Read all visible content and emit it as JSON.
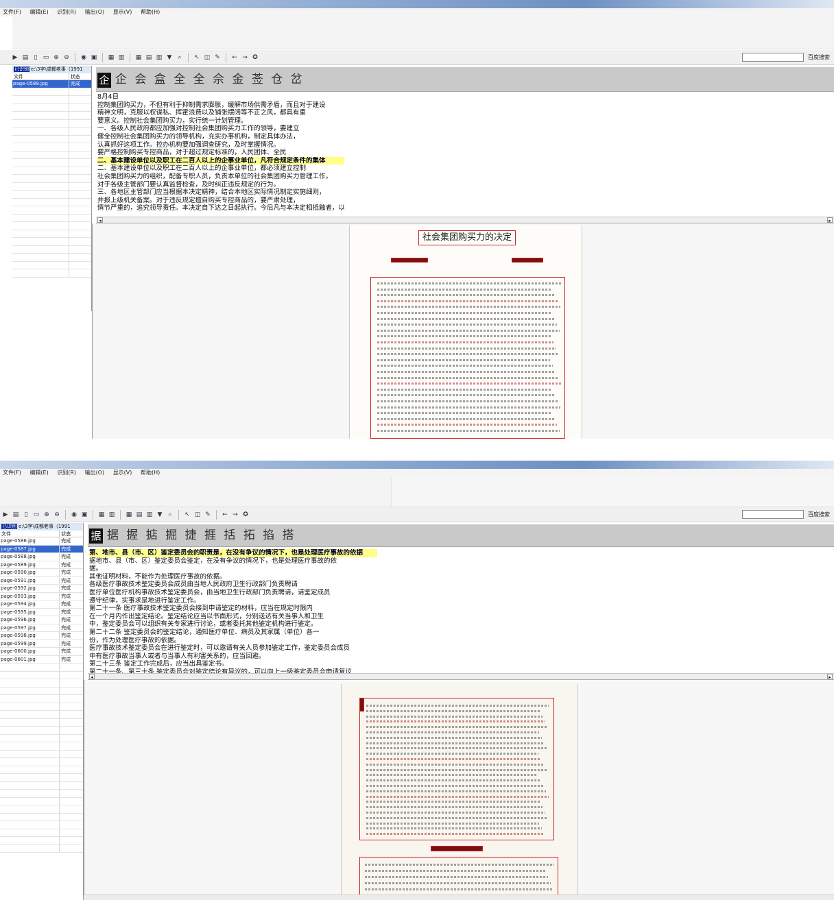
{
  "window1": {
    "title": "",
    "menu": [
      "文件(F)",
      "编辑(E)",
      "识别(R)",
      "输出(O)",
      "显示(V)",
      "帮助(H)"
    ],
    "search_placeholder": "",
    "search_button": "百度搜索",
    "sidebar": {
      "header_tag": "已识别",
      "header_text": "e:\\3字\\成都老事（1991",
      "col_file": "文件",
      "col_status": "状态",
      "rows": [
        {
          "file": "page-0589.jpg",
          "status": "完成",
          "selected": true
        }
      ]
    },
    "glyph_candidates": {
      "selected": "企",
      "candidates": "企 会 盒 全   全 佘 金 莶   仓 岔"
    },
    "text_lines": [
      {
        "text": "8月4日",
        "style": "plain"
      },
      {
        "text": "控制集团购买力，不但有利于抑制需求膨胀，缓解市场供需矛盾，而且对于建设",
        "style": "plain"
      },
      {
        "text": "精神文明，克服以权谋私、挥霍浪费以及铺张摆阔等不正之风，都具有重",
        "style": "plain"
      },
      {
        "text": "要意义。控制社会集团购买力，实行统一计划管理。",
        "style": "plain"
      },
      {
        "text": "一、各级人民政府都应加强对控制社会集团购买力工作的领导，要建立",
        "style": "plain"
      },
      {
        "text": "健全控制社会集团购买力的领导机构，充实办事机构，制定具体办法，",
        "style": "plain"
      },
      {
        "text": "认真抓好这项工作。控办机构要加强调查研究，及时掌握情况。",
        "style": "plain"
      },
      {
        "text": "要严格控制购买专控商品，对于超过规定标准的，人民团体、全民",
        "style": "plain"
      },
      {
        "text": "二、基本建设单位以及职工在二百人以上的企事业单位，凡符合规定条件的集体",
        "style": "hl"
      },
      {
        "text": "二、基本建设单位以及职工在二百人以上的企事业单位，都必须建立控制",
        "style": "plain"
      },
      {
        "text": "社会集团购买力的组织，配备专职人员，负责本单位的社会集团购买力管理工作，",
        "style": "plain"
      },
      {
        "text": "对于各级主管部门要认真监督检查，及时纠正违反规定的行为。",
        "style": "plain"
      },
      {
        "text": "",
        "style": "plain"
      },
      {
        "text": "三、各地区主管部门应当根据本决定精神，结合本地区实际情况制定实施细则，",
        "style": "plain"
      },
      {
        "text": "并报上级机关备案。对于违反规定擅自购买专控商品的，要严肃处理，",
        "style": "plain"
      },
      {
        "text": "情节严重的，追究领导责任。本决定自下达之日起执行。今后凡与本决定相抵触者，以本决定为准",
        "style": "plain"
      }
    ],
    "scan": {
      "title": "社会集团购买力的决定"
    }
  },
  "window2": {
    "title": "",
    "menu": [
      "文件(F)",
      "编辑(E)",
      "识别(R)",
      "输出(O)",
      "显示(V)",
      "帮助(H)"
    ],
    "search_placeholder": "",
    "search_button": "百度搜索",
    "sidebar": {
      "header_tag": "已识别",
      "header_text": "e:\\3字\\成都老事（1991",
      "col_file": "文件",
      "col_status": "状态",
      "rows": [
        {
          "file": "page-0586.jpg",
          "status": "完成",
          "selected": false
        },
        {
          "file": "page-0587.jpg",
          "status": "完成",
          "selected": true
        },
        {
          "file": "page-0588.jpg",
          "status": "完成",
          "selected": false
        },
        {
          "file": "page-0589.jpg",
          "status": "完成",
          "selected": false
        },
        {
          "file": "page-0590.jpg",
          "status": "完成",
          "selected": false
        },
        {
          "file": "page-0591.jpg",
          "status": "完成",
          "selected": false
        },
        {
          "file": "page-0592.jpg",
          "status": "完成",
          "selected": false
        },
        {
          "file": "page-0593.jpg",
          "status": "完成",
          "selected": false
        },
        {
          "file": "page-0594.jpg",
          "status": "完成",
          "selected": false
        },
        {
          "file": "page-0595.jpg",
          "status": "完成",
          "selected": false
        },
        {
          "file": "page-0596.jpg",
          "status": "完成",
          "selected": false
        },
        {
          "file": "page-0597.jpg",
          "status": "完成",
          "selected": false
        },
        {
          "file": "page-0598.jpg",
          "status": "完成",
          "selected": false
        },
        {
          "file": "page-0599.jpg",
          "status": "完成",
          "selected": false
        },
        {
          "file": "page-0600.jpg",
          "status": "完成",
          "selected": false
        },
        {
          "file": "page-0601.jpg",
          "status": "完成",
          "selected": false
        }
      ]
    },
    "glyph_candidates": {
      "selected": "据",
      "candidates": "据 握 掂 掘   捷 捱 括 拓   掐 搭"
    },
    "text_lines": [
      {
        "text": "第、地市、县（市、区）鉴定委员会的职责是，在没有争议的情况下，也是处理医疗事故的依据",
        "style": "hl"
      },
      {
        "text": "据地市、县（市、区）鉴定委员会鉴定，在没有争议的情况下，也是处理医疗事故的依",
        "style": "plain"
      },
      {
        "text": "据。",
        "style": "plain"
      },
      {
        "text": "    其他证明材料，不能作为处理医疗事故的依据。",
        "style": "plain"
      },
      {
        "text": "    各级医疗事故技术鉴定委员会成员由当地人民政府卫生行政部门负责聘请",
        "style": "plain"
      },
      {
        "text": "医疗单位医疗机构事故技术鉴定委员会，由当地卫生行政部门负责聘请，请鉴定成员",
        "style": "plain"
      },
      {
        "text": "遵守纪律，实事求是地进行鉴定工作。",
        "style": "plain"
      },
      {
        "text": "    第二十一条  医疗事故技术鉴定委员会接到申请鉴定的材料，应当在规定时限内",
        "style": "plain"
      },
      {
        "text": "在一个月内作出鉴定结论。鉴定结论应当以书面形式，分别送达有关当事人和卫生",
        "style": "plain"
      },
      {
        "text": "中，鉴定委员会可以组织有关专家进行讨论，或者委托其他鉴定机构进行鉴定。",
        "style": "plain"
      },
      {
        "text": "    第二十二条  鉴定委员会的鉴定结论，通知医疗单位、病员及其家属（单位）各一",
        "style": "plain"
      },
      {
        "text": "份，作为处理医疗事故的依据。",
        "style": "plain"
      },
      {
        "text": "    医疗事故技术鉴定委员会在进行鉴定时，可以邀请有关人员参加鉴定工作，鉴定委员会成员",
        "style": "plain"
      },
      {
        "text": "中有医疗事故当事人或者与当事人有利害关系的，应当回避。",
        "style": "plain"
      },
      {
        "text": "    第二十三条  鉴定工作完成后，应当出具鉴定书。",
        "style": "plain"
      },
      {
        "text": "    第二十一条、第三十条  鉴定委员会对鉴定结论有异议的，可以向上一级鉴定委员会申请复议",
        "style": "plain"
      }
    ]
  }
}
